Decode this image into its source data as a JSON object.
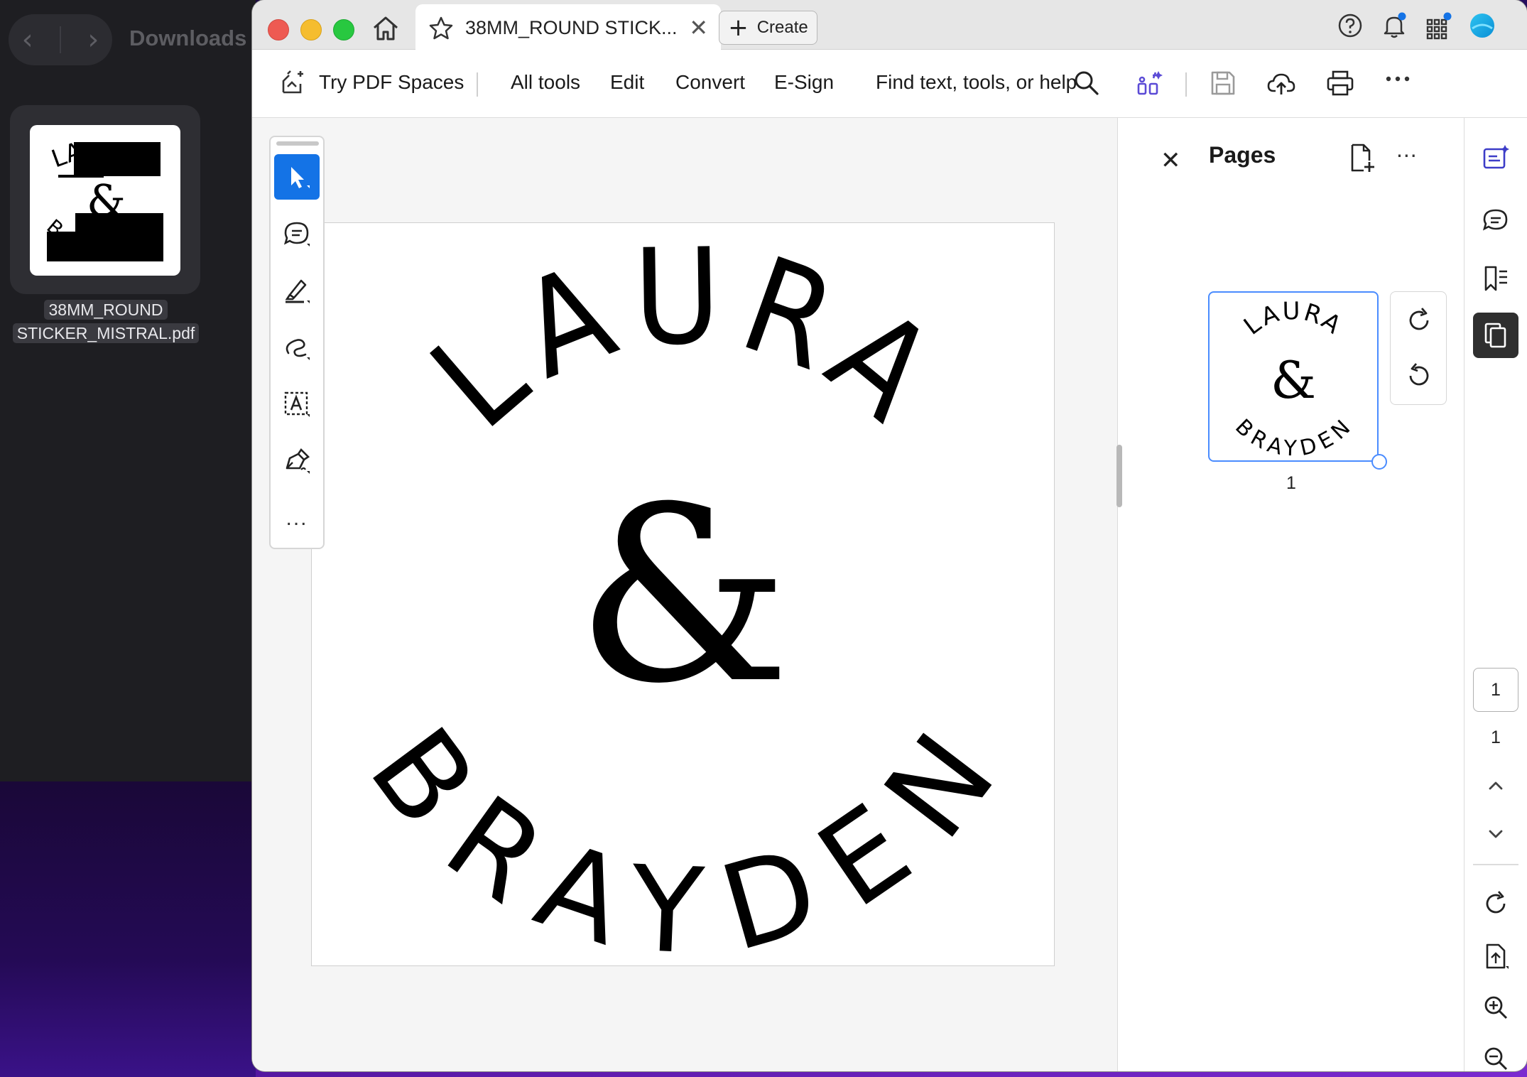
{
  "finder": {
    "title": "Downloads",
    "file_label_line1": "38MM_ROUND",
    "file_label_line2": "STICKER_MISTRAL.pdf"
  },
  "titlebar": {
    "tab_title": "38MM_ROUND STICK...",
    "tab_close": "✕",
    "create_plus": "+",
    "create_label": "Create"
  },
  "toolbar": {
    "try_pdf_spaces": "Try PDF Spaces",
    "all_tools": "All tools",
    "edit": "Edit",
    "convert": "Convert",
    "esign": "E-Sign",
    "find": "Find text, tools, or help"
  },
  "rail": {
    "more": "..."
  },
  "document": {
    "top_text": "LAURA",
    "ampersand": "&",
    "bottom_text": "BRAYDEN"
  },
  "pages_panel": {
    "close": "✕",
    "title": "Pages",
    "more": "...",
    "thumb_page_number": "1"
  },
  "right_rail": {
    "current_page": "1",
    "total_pages": "1"
  },
  "colors": {
    "accent_blue": "#1473e6",
    "thumb_border": "#4a8cff",
    "desktop_purple": "#2a0d6b"
  }
}
